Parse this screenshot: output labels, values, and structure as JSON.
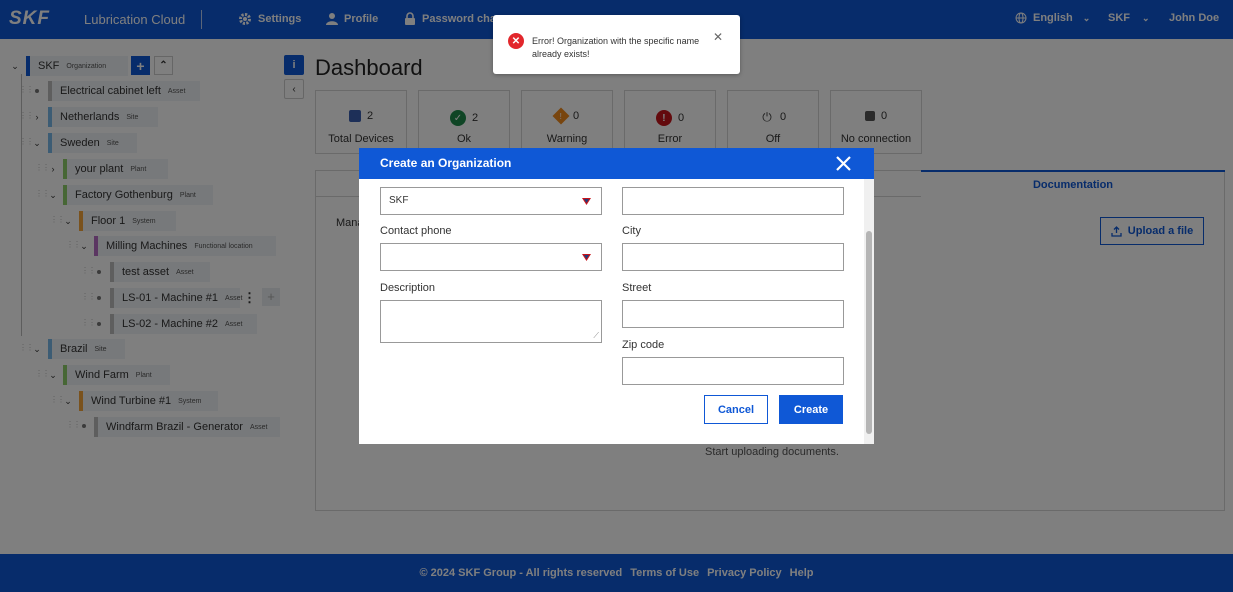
{
  "header": {
    "logo": "SKF",
    "app_name": "Lubrication Cloud",
    "nav": {
      "settings": "Settings",
      "profile": "Profile",
      "password": "Password cha"
    },
    "language": "English",
    "organization": "SKF",
    "user": "John Doe"
  },
  "tree": {
    "nodes": [
      {
        "label": "SKF",
        "type": "Organization"
      },
      {
        "label": "Electrical cabinet left",
        "type": "Asset"
      },
      {
        "label": "Netherlands",
        "type": "Site"
      },
      {
        "label": "Sweden",
        "type": "Site"
      },
      {
        "label": "your plant",
        "type": "Plant"
      },
      {
        "label": "Factory Gothenburg",
        "type": "Plant"
      },
      {
        "label": "Floor 1",
        "type": "System"
      },
      {
        "label": "Milling Machines",
        "type": "Functional location"
      },
      {
        "label": "test asset",
        "type": "Asset"
      },
      {
        "label": "LS-01 - Machine #1",
        "type": "Asset"
      },
      {
        "label": "LS-02 - Machine #2",
        "type": "Asset"
      },
      {
        "label": "Brazil",
        "type": "Site"
      },
      {
        "label": "Wind Farm",
        "type": "Plant"
      },
      {
        "label": "Wind Turbine #1",
        "type": "System"
      },
      {
        "label": "Windfarm Brazil - Generator",
        "type": "Asset"
      }
    ]
  },
  "dashboard": {
    "title": "Dashboard",
    "stats": [
      {
        "count": "2",
        "label": "Total Devices"
      },
      {
        "count": "2",
        "label": "Ok"
      },
      {
        "count": "0",
        "label": "Warning"
      },
      {
        "count": "0",
        "label": "Error"
      },
      {
        "count": "0",
        "label": "Off"
      },
      {
        "count": "0",
        "label": "No connection"
      }
    ],
    "documentation_tab": "Documentation",
    "partial_label": "Mana",
    "upload_button": "Upload a file",
    "empty_text": "Start uploading documents."
  },
  "modal": {
    "title": "Create an Organization",
    "fields": {
      "name_value": "SKF",
      "contact_phone_label": "Contact phone",
      "description_label": "Description",
      "city_label": "City",
      "street_label": "Street",
      "zip_label": "Zip code"
    },
    "cancel": "Cancel",
    "create": "Create"
  },
  "toast": {
    "message": "Error! Organization with the specific name already exists!"
  },
  "footer": {
    "copyright": "© 2024 SKF Group - All rights reserved",
    "terms": "Terms of Use",
    "privacy": "Privacy Policy",
    "help": "Help"
  },
  "colors": {
    "primary": "#0f58d6",
    "error": "#e2272c",
    "ok": "#1e8a4a",
    "warning": "#f08a1c"
  }
}
